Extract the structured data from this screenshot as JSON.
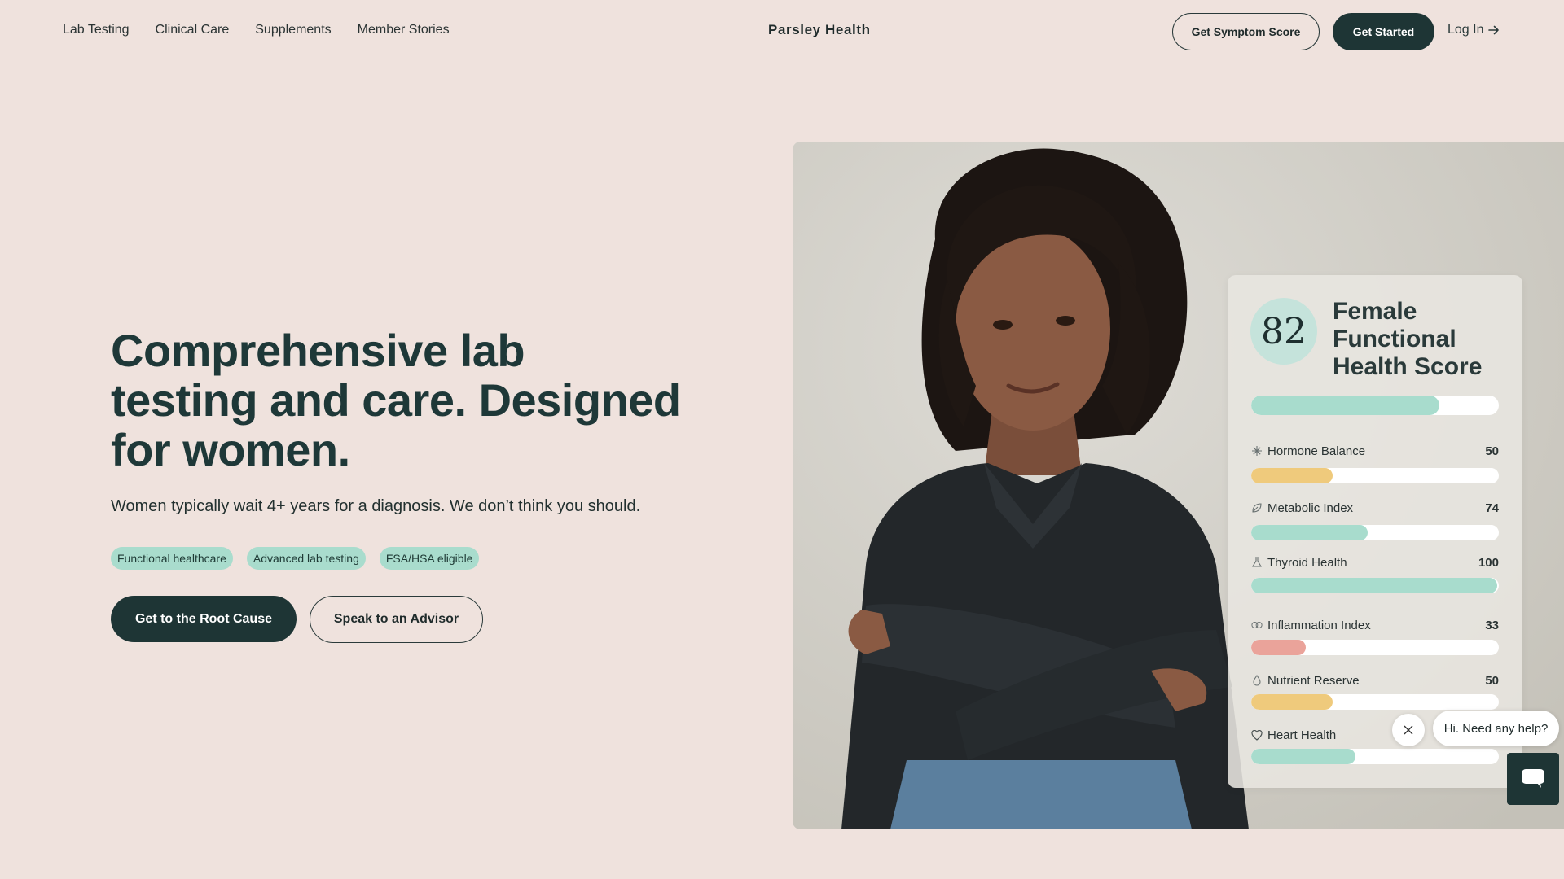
{
  "nav": {
    "links": [
      "Lab Testing",
      "Clinical Care",
      "Supplements",
      "Member Stories"
    ],
    "brand": "Parsley Health",
    "symptom_button": "Get Symptom Score",
    "started_button": "Get Started",
    "login": "Log In"
  },
  "hero": {
    "title": "Comprehensive lab testing and care. Designed for women.",
    "subtitle": "Women typically wait 4+ years for a diagnosis. We don’t think you should.",
    "tags": [
      "Functional healthcare",
      "Advanced lab testing",
      "FSA/HSA eligible"
    ],
    "primary_cta": "Get to the Root Cause",
    "secondary_cta": "Speak to an Advisor"
  },
  "score_card": {
    "score": "82",
    "title": "Female Functional Health Score",
    "overall_fraction": 0.76,
    "metrics": [
      {
        "label": "Hormone Balance",
        "value": "50",
        "fraction": 0.33,
        "color": "#efca7c",
        "icon": "sparkle-icon"
      },
      {
        "label": "Metabolic Index",
        "value": "74",
        "fraction": 0.47,
        "color": "#a8dccd",
        "icon": "leaf-icon"
      },
      {
        "label": "Thyroid Health",
        "value": "100",
        "fraction": 0.995,
        "color": "#a8dccd",
        "icon": "flask-icon"
      },
      {
        "label": "Inflammation Index",
        "value": "33",
        "fraction": 0.22,
        "color": "#eaa39a",
        "icon": "link-icon"
      },
      {
        "label": "Nutrient Reserve",
        "value": "50",
        "fraction": 0.33,
        "color": "#efca7c",
        "icon": "drop-icon"
      },
      {
        "label": "Heart Health",
        "value": "",
        "fraction": 0.42,
        "color": "#a8dccd",
        "icon": "heart-icon"
      }
    ]
  },
  "chat": {
    "bubble": "Hi. Need any help?"
  },
  "colors": {
    "page_bg": "#efe2dd",
    "dark_green": "#1e3535",
    "mint": "#a9dccd"
  }
}
